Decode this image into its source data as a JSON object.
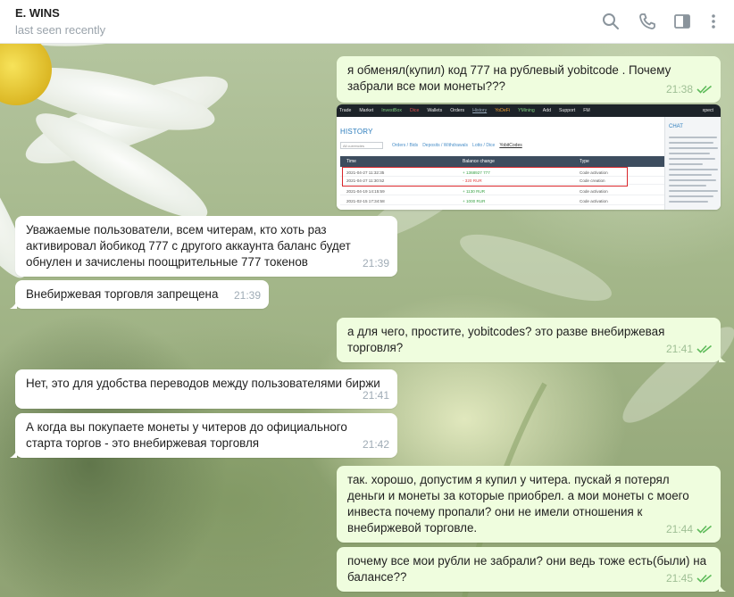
{
  "header": {
    "title": "E. WINS",
    "status": "last seen recently",
    "icons": [
      "search-icon",
      "phone-icon",
      "sidebar-toggle-icon",
      "more-vertical-icon"
    ]
  },
  "colors": {
    "outgoing_bubble": "#effdde",
    "incoming_bubble": "#ffffff",
    "read_check": "#5ebb5a",
    "header_bg": "#ffffff"
  },
  "messages": [
    {
      "direction": "out",
      "text": "я обменял(купил) код 777 на рублевый yobitcode . Почему забрали все мои монеты???",
      "time": "21:38",
      "read": true
    },
    {
      "direction": "out",
      "type": "image"
    },
    {
      "direction": "in",
      "text": "Уважаемые пользователи, всем читерам, кто хоть раз активировал йобикод 777 с другого аккаунта баланс будет обнулен и зачислены поощрительные 777 токенов",
      "time": "21:39"
    },
    {
      "direction": "in",
      "text": "Внебиржевая торговля запрещена",
      "time": "21:39"
    },
    {
      "direction": "out",
      "text": "а для чего, простите, yobitcodes? это разве внебиржевая торговля?",
      "time": "21:41",
      "read": true
    },
    {
      "direction": "in",
      "text": "Нет, это для удобства переводов между пользователями биржи",
      "time": "21:41"
    },
    {
      "direction": "in",
      "text": "А когда вы покупаете монеты у читеров до официального старта торгов - это внебиржевая торговля",
      "time": "21:42"
    },
    {
      "direction": "out",
      "text": "так. хорошо, допустим я купил у читера. пускай я потерял деньги и монеты за которые приобрел. а мои монеты с моего инвеста почему пропали? они не имели отношения к внебиржевой торговле.",
      "time": "21:44",
      "read": true
    },
    {
      "direction": "out",
      "text": "почему все мои рубли не забрали? они ведь тоже есть(были) на балансе??",
      "time": "21:45",
      "read": true
    }
  ],
  "screenshot": {
    "nav": [
      "Trade",
      "Market",
      "InvestBox",
      "Dice",
      "Wallets",
      "Orders",
      "History",
      "YoDeFi",
      "YMining",
      "Add",
      "Support",
      "FM"
    ],
    "user": "xpect",
    "history_title": "HISTORY",
    "select_value": "All currencies",
    "tabs": [
      "Orders / Bids",
      "Deposits / Withdrawals",
      "Lotto / Dice",
      "YobitCodes"
    ],
    "columns": [
      "Time",
      "Balance change",
      "Type"
    ],
    "rows": [
      [
        "2021-04-27 11:32:35",
        "+ 1368927 777",
        "Code activation"
      ],
      [
        "2021-04-27 11:30:52",
        "- 320 RUR",
        "Code creation"
      ],
      [
        "2021-04-19 14:15:59",
        "+ 1130 RUR",
        "Code activation"
      ],
      [
        "2021-02-15 17:34:58",
        "+ 1000 RUR",
        "Code activation"
      ]
    ],
    "chat_title": "CHAT"
  }
}
